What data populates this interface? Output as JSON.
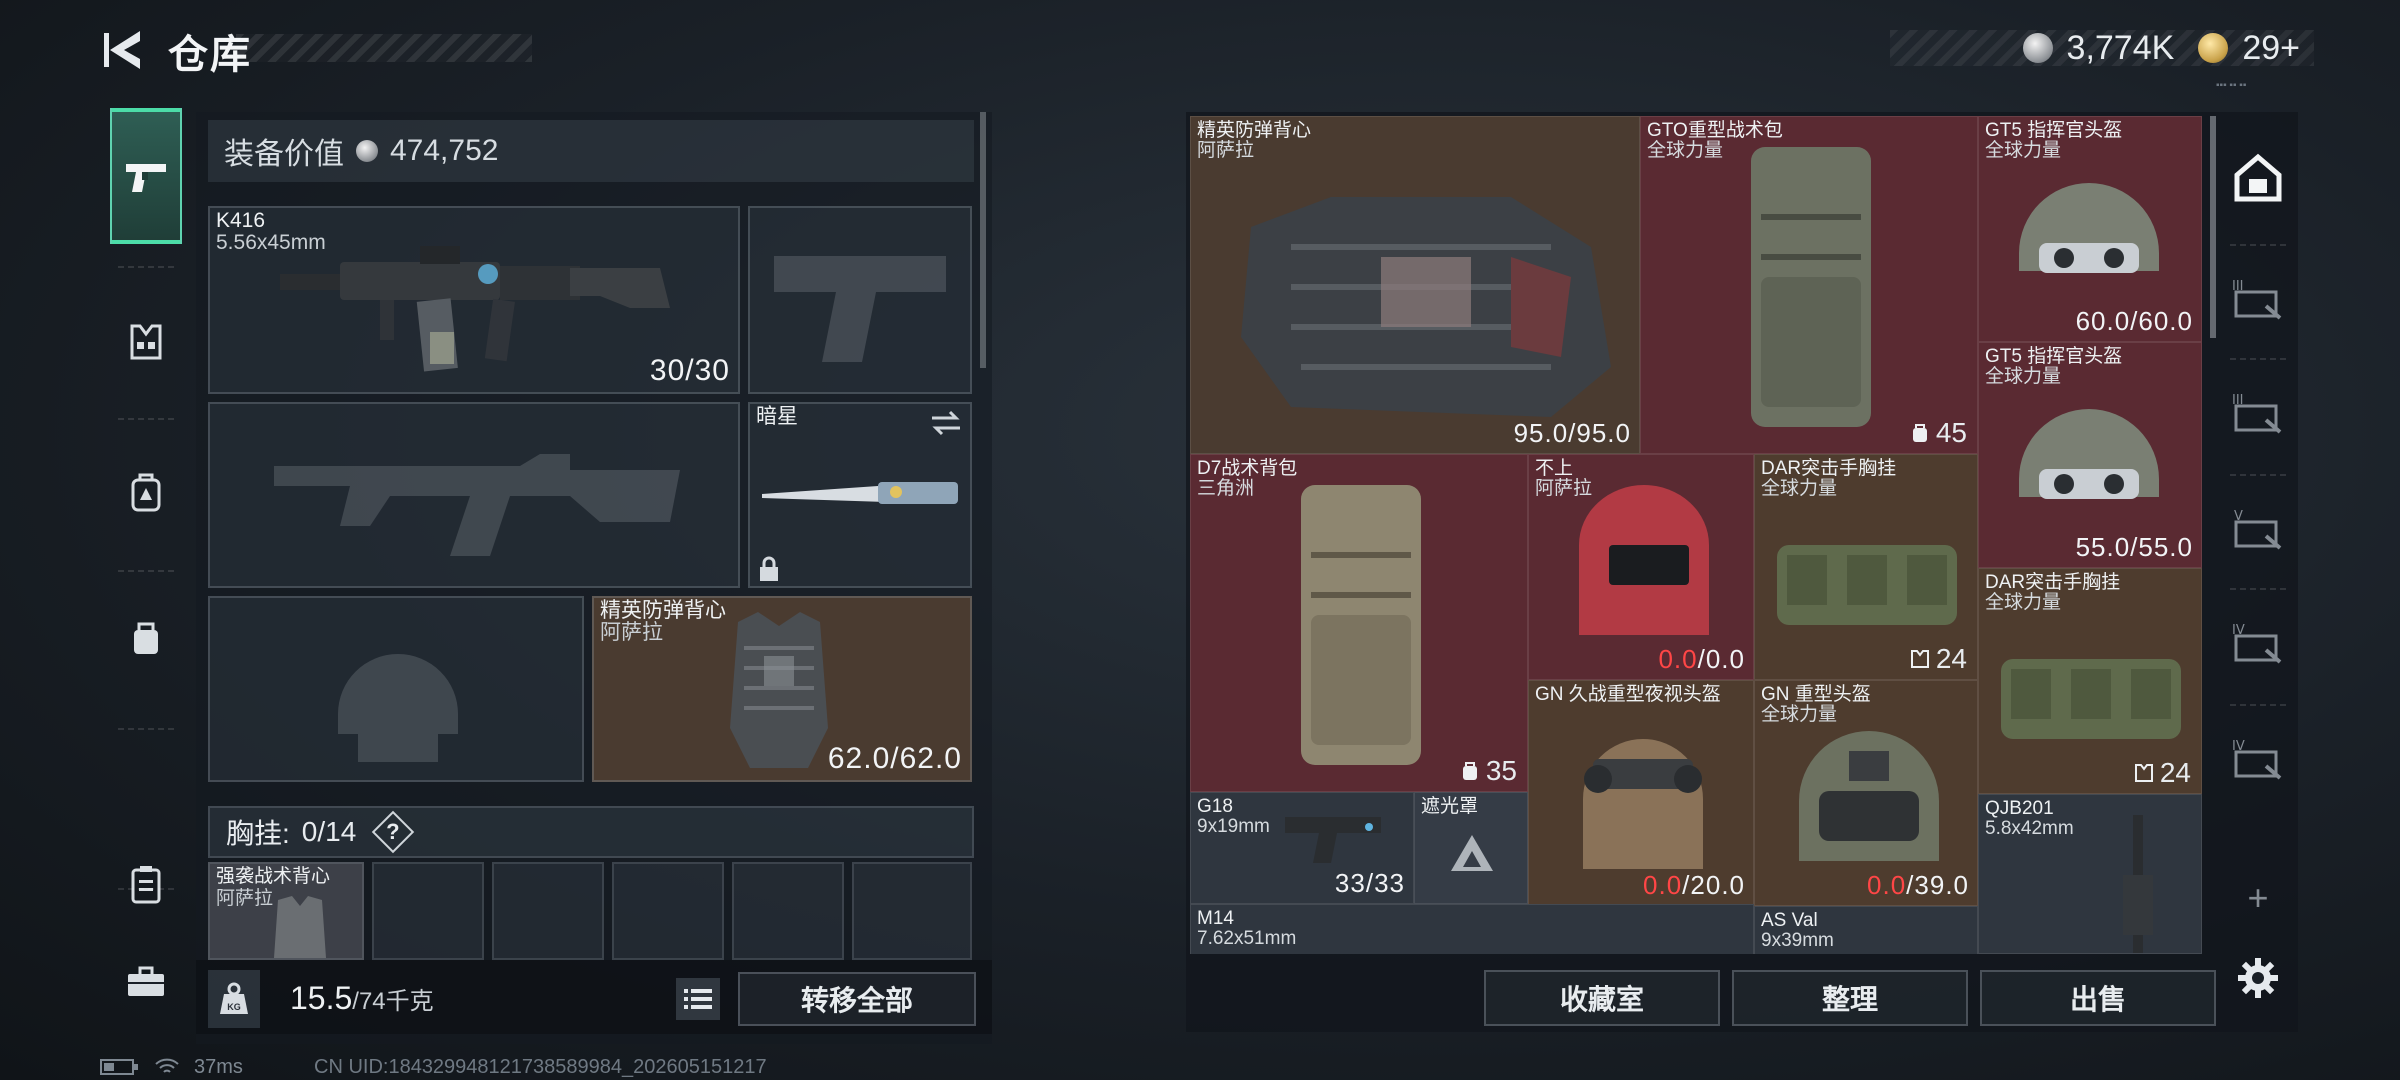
{
  "header": {
    "title": "仓库",
    "currency_silver": "3,774K",
    "currency_gold": "29",
    "currency_gold_plus": "+"
  },
  "left_nav": {
    "items": [
      {
        "name": "weapons",
        "icon": "pistol-icon",
        "active": true
      },
      {
        "name": "armor",
        "icon": "chest-rig-icon"
      },
      {
        "name": "backpack",
        "icon": "backpack-icon"
      },
      {
        "name": "pouch",
        "icon": "pouch-icon"
      },
      {
        "name": "supplies",
        "icon": "medkit-icon"
      },
      {
        "name": "toolbox",
        "icon": "briefcase-icon"
      }
    ]
  },
  "loadout": {
    "equip_value_label": "装备价值",
    "equip_value": "474,752",
    "primary": {
      "name": "K416",
      "caliber": "5.56x45mm",
      "ammo": "30/30"
    },
    "melee": {
      "name": "暗星"
    },
    "armor": {
      "name": "精英防弹背心",
      "maker": "阿萨拉",
      "durability": "62.0/62.0"
    },
    "vest_label": "胸挂:",
    "vest_count": "0/14",
    "vest_help": "?",
    "vest_item": {
      "name": "强袭战术背心",
      "maker": "阿萨拉"
    },
    "weight_current": "15.5",
    "weight_max": "/74千克",
    "transfer_all": "转移全部"
  },
  "storage": {
    "items": [
      {
        "name": "精英防弹背心",
        "sub": "阿萨拉",
        "value": "95.0/95.0"
      },
      {
        "name": "GTO重型战术包",
        "sub": "全球力量",
        "count": "45"
      },
      {
        "name": "GT5 指挥官头盔",
        "sub": "全球力量",
        "value": "60.0/60.0"
      },
      {
        "name": "GT5 指挥官头盔",
        "sub": "全球力量",
        "value": "55.0/55.0"
      },
      {
        "name": "D7战术背包",
        "sub": "三角洲",
        "count": "35"
      },
      {
        "name": "不上",
        "sub": "阿萨拉",
        "value_red": "0.0",
        "value_rest": "/0.0"
      },
      {
        "name": "DAR突击手胸挂",
        "sub": "全球力量",
        "count": "24"
      },
      {
        "name": "DAR突击手胸挂",
        "sub": "全球力量",
        "count": "24"
      },
      {
        "name": "G18",
        "sub": "9x19mm",
        "value": "33/33"
      },
      {
        "name": "遮光罩"
      },
      {
        "name": "GN 久战重型夜视头盔",
        "value_red": "0.0",
        "value_rest": "/20.0"
      },
      {
        "name": "GN 重型头盔",
        "sub": "全球力量",
        "value_red": "0.0",
        "value_rest": "/39.0"
      },
      {
        "name": "QJB201",
        "sub": "5.8x42mm"
      },
      {
        "name": "M14",
        "sub": "7.62x51mm"
      },
      {
        "name": "AS Val",
        "sub": "9x39mm"
      }
    ],
    "buttons": {
      "collection": "收藏室",
      "sort": "整理",
      "sell": "出售"
    }
  },
  "right_nav": {
    "items": [
      {
        "icon": "home-safe-icon",
        "active": true
      },
      {
        "icon": "storage-tier-3-icon",
        "tier": "III"
      },
      {
        "icon": "storage-tier-3b-icon",
        "tier": "III"
      },
      {
        "icon": "storage-tier-5-icon",
        "tier": "V"
      },
      {
        "icon": "storage-tier-4-icon",
        "tier": "IV"
      },
      {
        "icon": "storage-tier-4b-icon",
        "tier": "IV"
      }
    ],
    "add": "+"
  },
  "status": {
    "ping": "37ms",
    "uid": "CN UID:184329948121738589984_202605151217"
  },
  "colors": {
    "accent": "#4cdca8",
    "red_slot": "#5a2a32",
    "brown_slot": "#4a3b30",
    "warning": "#ff4646"
  }
}
